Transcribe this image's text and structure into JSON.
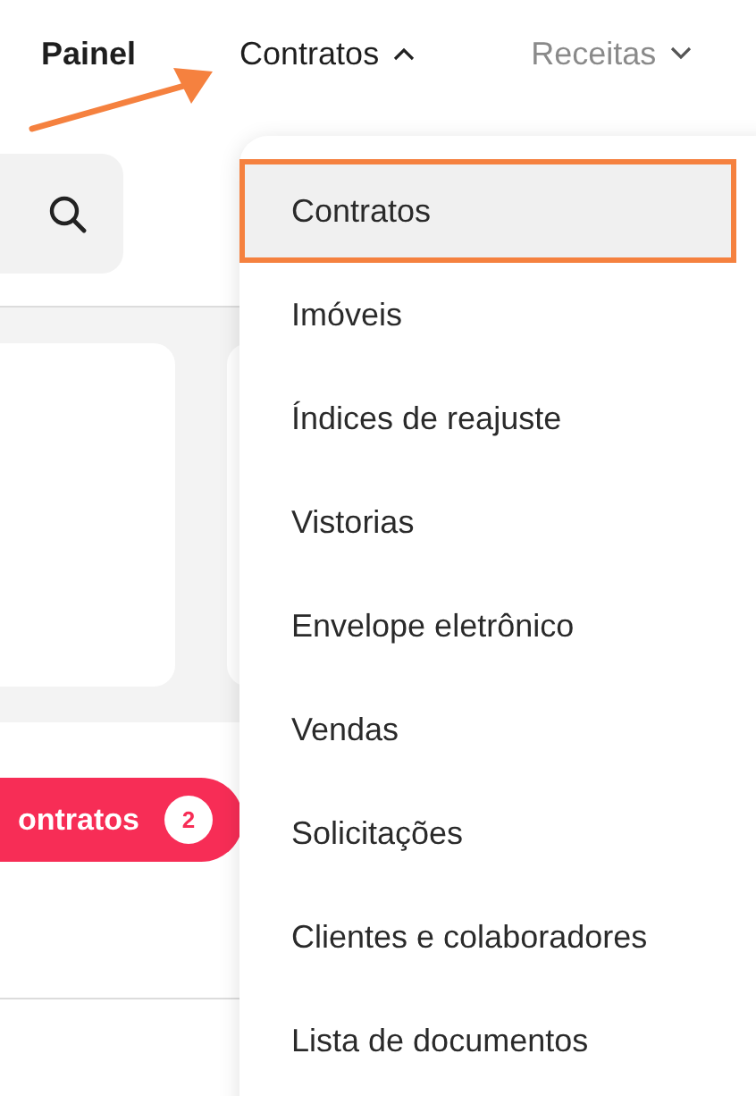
{
  "nav": [
    {
      "label": "Painel",
      "kind": "plain",
      "selected": true
    },
    {
      "label": "Contratos",
      "kind": "dropdown",
      "selected": false,
      "expanded": true
    },
    {
      "label": "Receitas",
      "kind": "dropdown",
      "selected": false,
      "expanded": false
    }
  ],
  "menu": {
    "items": [
      {
        "label": "Contratos",
        "highlighted": true
      },
      {
        "label": "Imóveis",
        "highlighted": false
      },
      {
        "label": "Índices de reajuste",
        "highlighted": false
      },
      {
        "label": "Vistorias",
        "highlighted": false
      },
      {
        "label": "Envelope eletrônico",
        "highlighted": false
      },
      {
        "label": "Vendas",
        "highlighted": false
      },
      {
        "label": "Solicitações",
        "highlighted": false
      },
      {
        "label": "Clientes e colaboradores",
        "highlighted": false
      },
      {
        "label": "Lista de documentos",
        "highlighted": false
      }
    ]
  },
  "pill": {
    "label": "ontratos",
    "count": "2"
  }
}
